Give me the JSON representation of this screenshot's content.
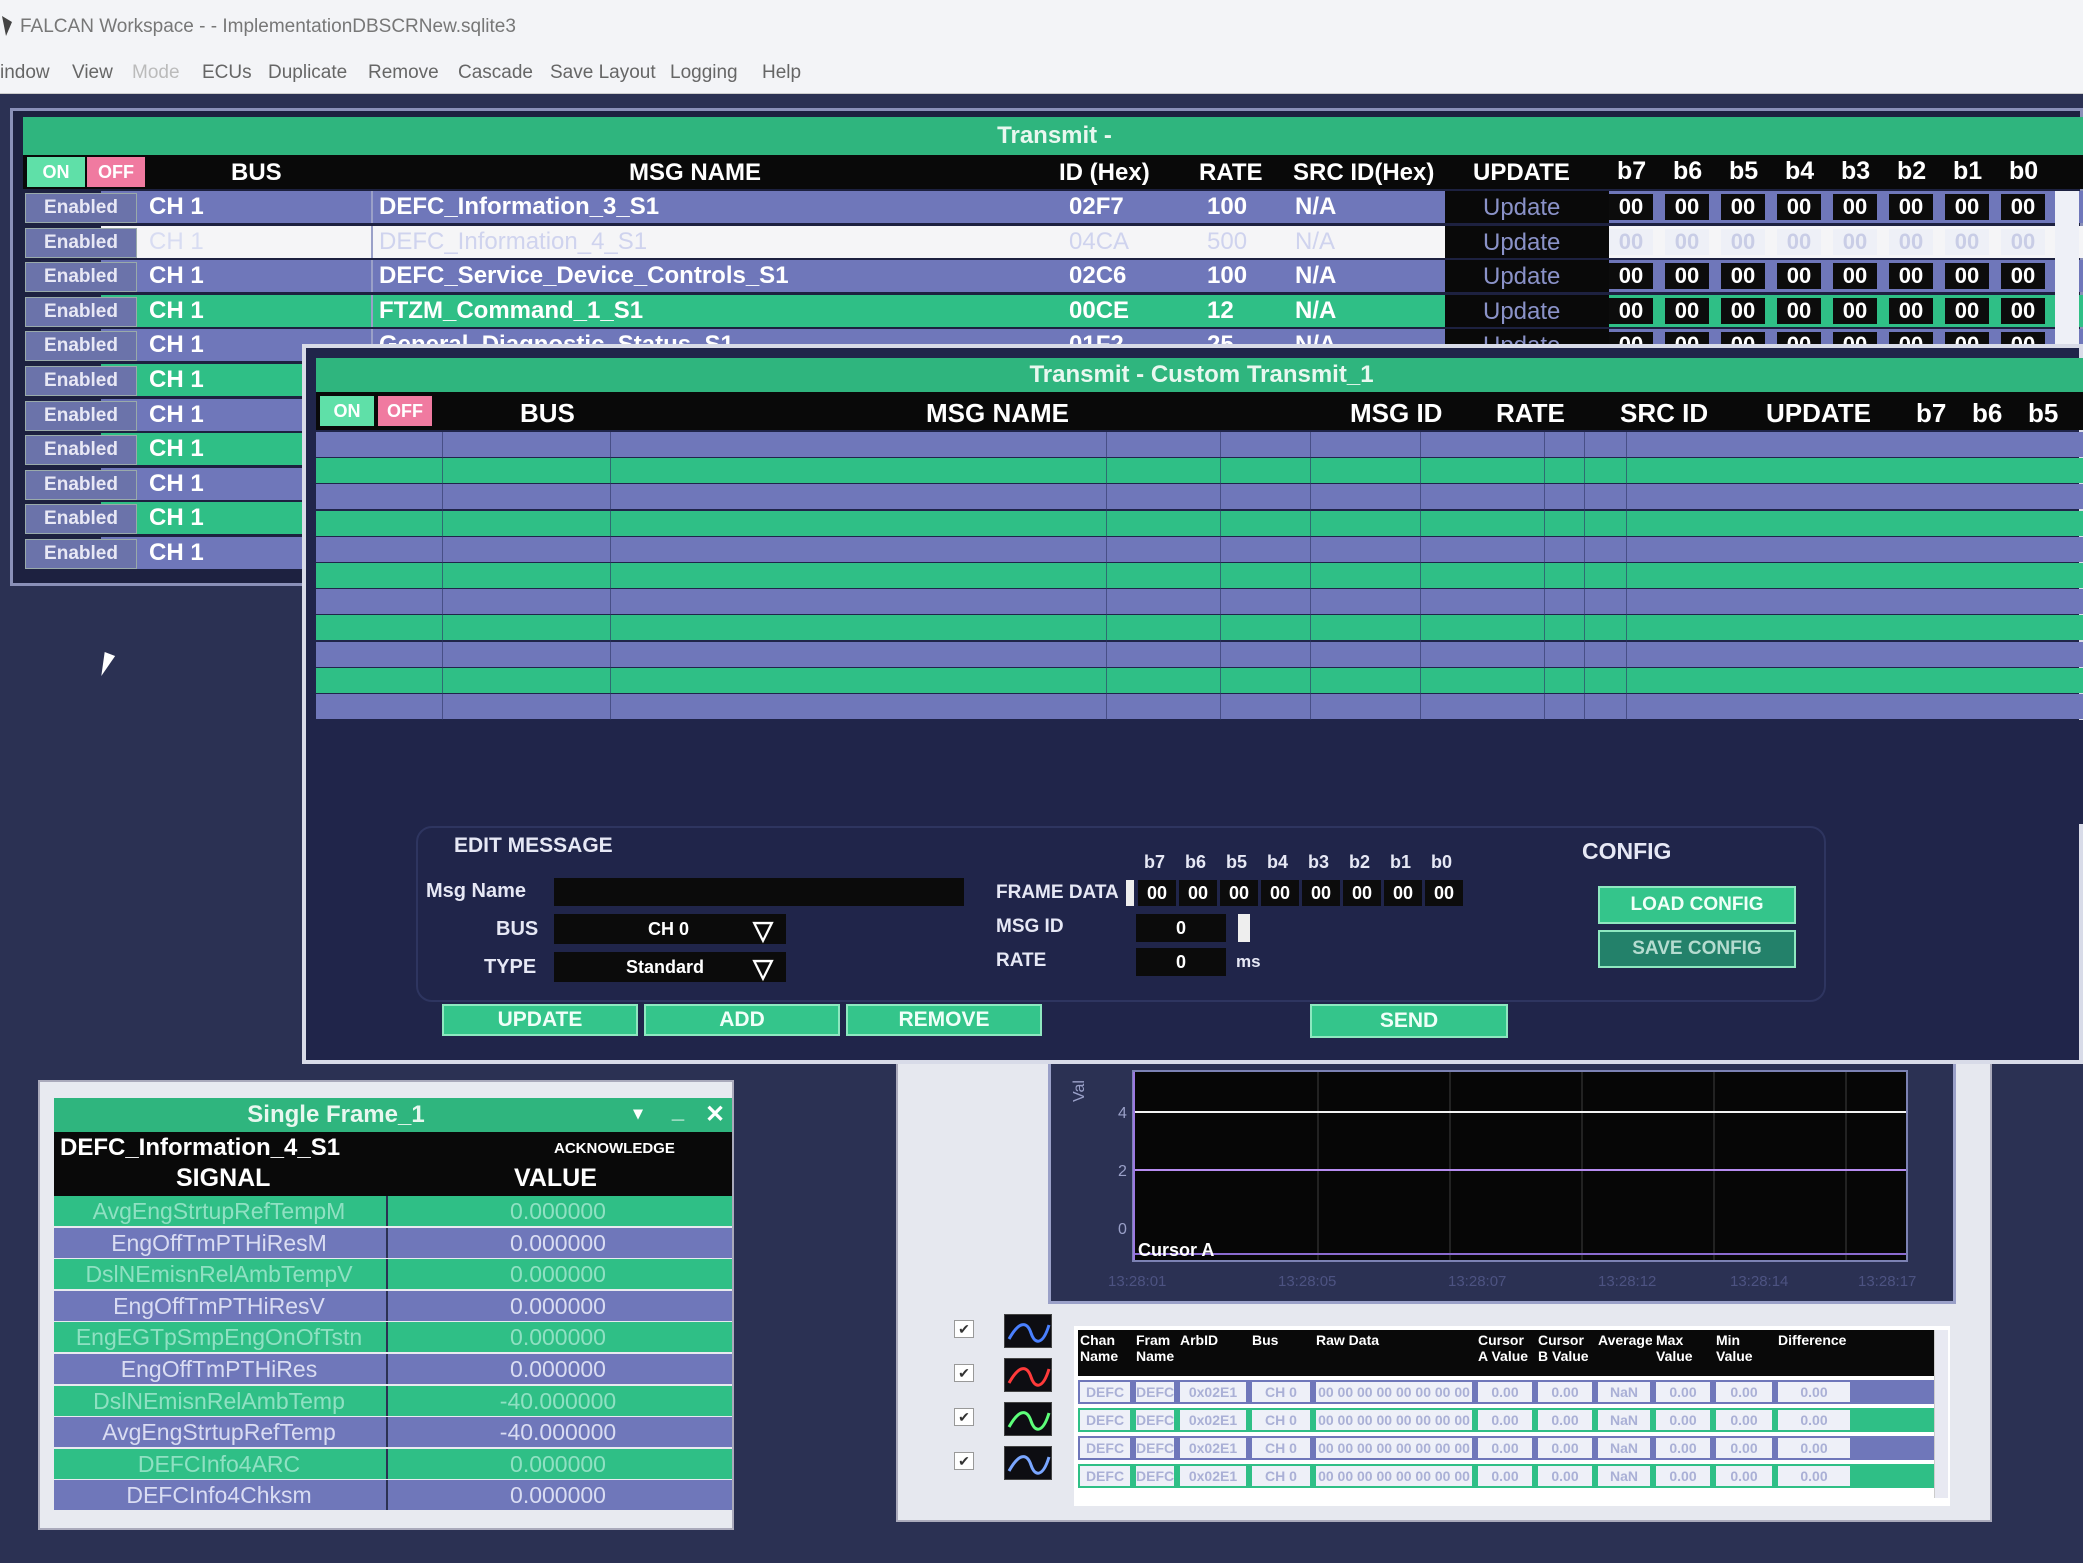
{
  "window": {
    "title": "FALCAN Workspace -  - ImplementationDBSCRNew.sqlite3"
  },
  "menu": [
    "indow",
    "View",
    "Mode",
    "ECUs",
    "Duplicate",
    "Remove",
    "Cascade",
    "Save Layout",
    "Logging",
    "Help"
  ],
  "transmit": {
    "title": "Transmit -",
    "on": "ON",
    "off": "OFF",
    "headers": {
      "bus": "BUS",
      "msg": "MSG NAME",
      "id": "ID (Hex)",
      "rate": "RATE",
      "src": "SRC ID(Hex)",
      "update": "UPDATE",
      "bytes": [
        "b7",
        "b6",
        "b5",
        "b4",
        "b3",
        "b2",
        "b1",
        "b0"
      ]
    },
    "rows": [
      {
        "state": "Enabled",
        "bus": "CH 1",
        "msg": "DEFC_Information_3_S1",
        "id": "02F7",
        "rate": "100",
        "src": "N/A",
        "update": "Update"
      },
      {
        "state": "Enabled",
        "bus": "CH 1",
        "msg": "DEFC_Information_4_S1",
        "id": "04CA",
        "rate": "500",
        "src": "N/A",
        "update": "Update"
      },
      {
        "state": "Enabled",
        "bus": "CH 1",
        "msg": "DEFC_Service_Device_Controls_S1",
        "id": "02C6",
        "rate": "100",
        "src": "N/A",
        "update": "Update"
      },
      {
        "state": "Enabled",
        "bus": "CH 1",
        "msg": "FTZM_Command_1_S1",
        "id": "00CE",
        "rate": "12",
        "src": "N/A",
        "update": "Update"
      },
      {
        "state": "Enabled",
        "bus": "CH 1",
        "msg": "General_Diagnostic_Status_S1",
        "id": "01F2",
        "rate": "25",
        "src": "N/A",
        "update": "Update"
      },
      {
        "state": "Enabled",
        "bus": "CH 1"
      },
      {
        "state": "Enabled",
        "bus": "CH 1"
      },
      {
        "state": "Enabled",
        "bus": "CH 1"
      },
      {
        "state": "Enabled",
        "bus": "CH 1"
      },
      {
        "state": "Enabled",
        "bus": "CH 1"
      },
      {
        "state": "Enabled",
        "bus": "CH 1"
      }
    ],
    "byte_value": "00"
  },
  "custom": {
    "title": "Transmit - Custom Transmit_1",
    "on": "ON",
    "off": "OFF",
    "headers": {
      "bus": "BUS",
      "msg": "MSG NAME",
      "id": "MSG ID",
      "rate": "RATE",
      "src": "SRC ID",
      "update": "UPDATE",
      "bytes": [
        "b7",
        "b6",
        "b5"
      ]
    },
    "edit": {
      "title": "EDIT MESSAGE",
      "msg_name_label": "Msg Name",
      "msg_name_value": "",
      "bus_label": "BUS",
      "bus_value": "CH 0",
      "type_label": "TYPE",
      "type_value": "Standard",
      "frame_label": "FRAME DATA",
      "frame_bytes_labels": [
        "b7",
        "b6",
        "b5",
        "b4",
        "b3",
        "b2",
        "b1",
        "b0"
      ],
      "frame_bytes": [
        "00",
        "00",
        "00",
        "00",
        "00",
        "00",
        "00",
        "00"
      ],
      "msgid_label": "MSG ID",
      "msgid_value": "0",
      "rate_label": "RATE",
      "rate_value": "0",
      "rate_unit": "ms",
      "update_btn": "UPDATE",
      "add_btn": "ADD",
      "remove_btn": "REMOVE",
      "send_btn": "SEND"
    },
    "config": {
      "title": "CONFIG",
      "load": "LOAD CONFIG",
      "save": "SAVE CONFIG"
    }
  },
  "single_frame": {
    "title": "Single Frame_1",
    "message": "DEFC_Information_4_S1",
    "ack": "ACKNOWLEDGE",
    "col_signal": "SIGNAL",
    "col_value": "VALUE",
    "rows": [
      {
        "signal": "AvgEngStrtupRefTempM",
        "value": "0.000000"
      },
      {
        "signal": "EngOffTmPTHiResM",
        "value": "0.000000"
      },
      {
        "signal": "DslNEmisnRelAmbTempV",
        "value": "0.000000"
      },
      {
        "signal": "EngOffTmPTHiResV",
        "value": "0.000000"
      },
      {
        "signal": "EngEGTpSmpEngOnOfTstn",
        "value": "0.000000"
      },
      {
        "signal": "EngOffTmPTHiRes",
        "value": "0.000000"
      },
      {
        "signal": "DslNEmisnRelAmbTemp",
        "value": "-40.000000"
      },
      {
        "signal": "AvgEngStrtupRefTemp",
        "value": "-40.000000"
      },
      {
        "signal": "DEFCInfo4ARC",
        "value": "0.000000"
      },
      {
        "signal": "DEFCInfo4Chksm",
        "value": "0.000000"
      }
    ]
  },
  "graph": {
    "y_ticks": [
      "4",
      "2",
      "0"
    ],
    "y_axis_label": "Val",
    "cursor_label": "Cursor A",
    "x_ticks": [
      "13:28:01",
      "13:28:05",
      "13:28:07",
      "13:28:12",
      "13:28:14",
      "13:28:17"
    ],
    "table_headers": [
      "Chan Name",
      "Fram Name",
      "ArbID",
      "Bus",
      "Raw Data",
      "Cursor A Value",
      "Cursor B Value",
      "Average",
      "Max Value",
      "Min Value",
      "Difference"
    ],
    "table_rows": [
      [
        "DEFC",
        "DEFC",
        "0x02E1",
        "CH 0",
        "00 00 00 00 00 00 00 00",
        "0.00",
        "0.00",
        "NaN",
        "0.00",
        "0.00",
        "0.00"
      ],
      [
        "DEFC",
        "DEFC",
        "0x02E1",
        "CH 0",
        "00 00 00 00 00 00 00 00",
        "0.00",
        "0.00",
        "NaN",
        "0.00",
        "0.00",
        "0.00"
      ],
      [
        "DEFC",
        "DEFC",
        "0x02E1",
        "CH 0",
        "00 00 00 00 00 00 00 00",
        "0.00",
        "0.00",
        "NaN",
        "0.00",
        "0.00",
        "0.00"
      ],
      [
        "DEFC",
        "DEFC",
        "0x02E1",
        "CH 0",
        "00 00 00 00 00 00 00 00",
        "0.00",
        "0.00",
        "NaN",
        "0.00",
        "0.00",
        "0.00"
      ]
    ],
    "legend_colors": [
      "#4a80ff",
      "#ff3a3a",
      "#5dff7a",
      "#7aa6ff"
    ]
  }
}
